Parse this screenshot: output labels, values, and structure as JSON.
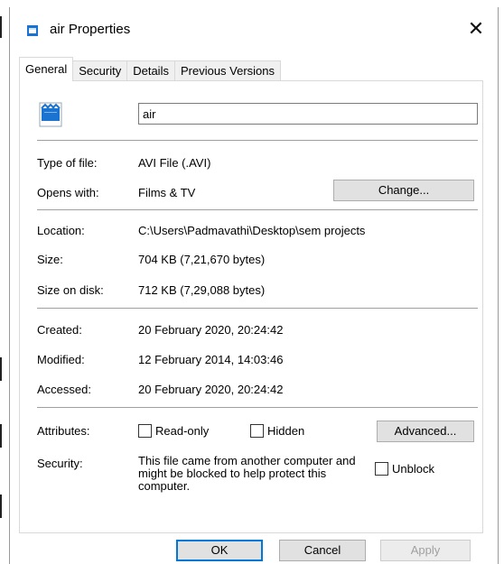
{
  "window": {
    "title": "air Properties",
    "close_glyph": "✕"
  },
  "tabs": [
    {
      "label": "General",
      "active": true
    },
    {
      "label": "Security",
      "active": false
    },
    {
      "label": "Details",
      "active": false
    },
    {
      "label": "Previous Versions",
      "active": false
    }
  ],
  "general": {
    "file_name": "air",
    "type_of_file": {
      "label": "Type of file:",
      "value": "AVI File (.AVI)"
    },
    "opens_with": {
      "label": "Opens with:",
      "value": "Films & TV",
      "button": "Change..."
    },
    "location": {
      "label": "Location:",
      "value": "C:\\Users\\Padmavathi\\Desktop\\sem projects"
    },
    "size": {
      "label": "Size:",
      "value": "704 KB (7,21,670 bytes)"
    },
    "size_on_disk": {
      "label": "Size on disk:",
      "value": "712 KB (7,29,088 bytes)"
    },
    "created": {
      "label": "Created:",
      "value": "20 February 2020, 20:24:42"
    },
    "modified": {
      "label": "Modified:",
      "value": "12 February 2014, 14:03:46"
    },
    "accessed": {
      "label": "Accessed:",
      "value": "20 February 2020, 20:24:42"
    },
    "attributes": {
      "label": "Attributes:",
      "read_only": "Read-only",
      "hidden": "Hidden",
      "advanced_button": "Advanced..."
    },
    "security": {
      "label": "Security:",
      "text": "This file came from another computer and might be blocked to help protect this computer.",
      "unblock": "Unblock"
    }
  },
  "footer": {
    "ok": "OK",
    "cancel": "Cancel",
    "apply": "Apply"
  },
  "icons": {
    "title": "video-file-icon",
    "file": "video-file-icon",
    "close": "close-icon"
  },
  "colors": {
    "accent": "#0078d7",
    "border": "#d9d9d9",
    "button_bg": "#e1e1e1"
  }
}
